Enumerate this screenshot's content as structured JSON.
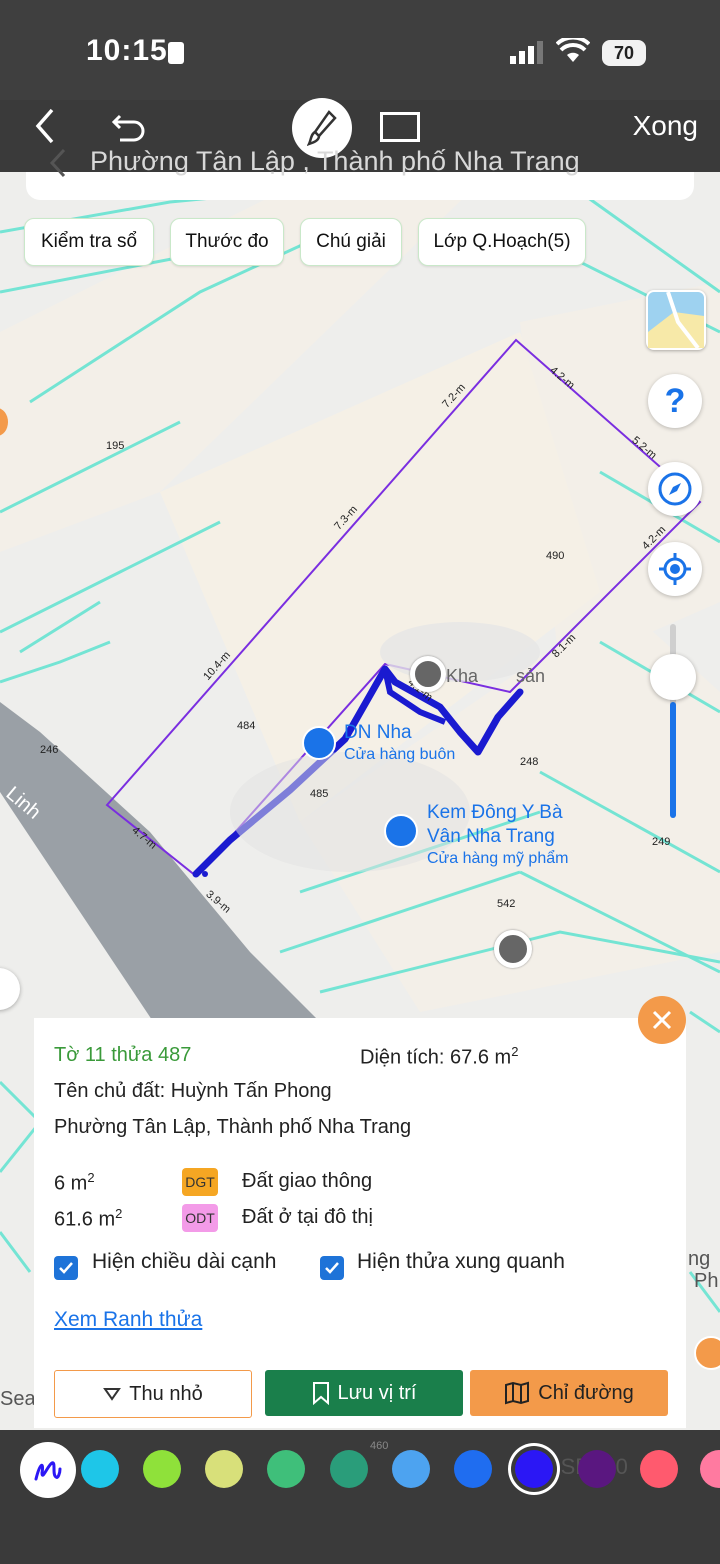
{
  "status_bar": {
    "time": "10:15",
    "battery": "70"
  },
  "editor": {
    "done_label": "Xong"
  },
  "header": {
    "title": "Phường Tân Lập , Thành phố Nha Trang"
  },
  "chips": [
    "Kiểm tra sổ",
    "Thước đo",
    "Chú giải",
    "Lớp Q.Hoạch(5)"
  ],
  "map": {
    "parcels": [
      "195",
      "490",
      "484",
      "246",
      "485",
      "248",
      "249",
      "542",
      "460"
    ],
    "edges": [
      "4.2-m",
      "7.2-m",
      "5.2-m",
      "7.3-m",
      "4.2-m",
      "10.4-m",
      "8.1-m",
      "4.1-m",
      "4.7-m",
      "3.9-m"
    ],
    "poi": [
      {
        "title": "DN Nha",
        "subtitle": "Cửa hàng  buôn"
      },
      {
        "title": "Kha",
        "subtitle": "sản"
      },
      {
        "title": "Kem Đông Y Bà",
        "title2": "Vân Nha Trang",
        "subtitle": "Cửa hàng mỹ phẩm"
      }
    ],
    "street": "Linh",
    "edge_text": [
      "ng",
      "Ph",
      "Sea"
    ]
  },
  "panel": {
    "sheet": "Tờ 11 thửa 487",
    "area_label": "Diện tích: 67.6 m",
    "area_sup": "2",
    "owner": "Tên chủ đất: Huỳnh Tấn Phong",
    "address": "Phường Tân Lập, Thành phố Nha Trang",
    "land_uses": [
      {
        "area": "6 m",
        "sup": "2",
        "code": "DGT",
        "name": "Đất giao thông",
        "color": "#f5a623"
      },
      {
        "area": "61.6 m",
        "sup": "2",
        "code": "ODT",
        "name": "Đất ở tại đô thị",
        "color": "#f39be8"
      }
    ],
    "check_edges": "Hiện chiều dài cạnh",
    "check_neighbors": "Hiện thửa xung quanh",
    "view_border_link": "Xem Ranh thửa",
    "buttons": {
      "collapse": "Thu nhỏ",
      "save": "Lưu vị trí",
      "directions": "Chỉ đường"
    }
  },
  "palette": {
    "colors": [
      "#1ec6e8",
      "#8fe13a",
      "#d8e07a",
      "#3fbf7a",
      "#2a9d7a",
      "#4da3f0",
      "#1f6df0",
      "#2b17f5",
      "#5a1780",
      "#ff5a6e",
      "#ff7aa0"
    ],
    "selected": "#2b17f5",
    "underlay_text": "pa    SDI   30"
  },
  "colors": {
    "accent_green": "#1a7f4b",
    "accent_orange": "#f39a4a",
    "link_blue": "#1a73e8",
    "parcel_outline": "#7a2ee0",
    "drawing_stroke": "#1a1ad0"
  }
}
